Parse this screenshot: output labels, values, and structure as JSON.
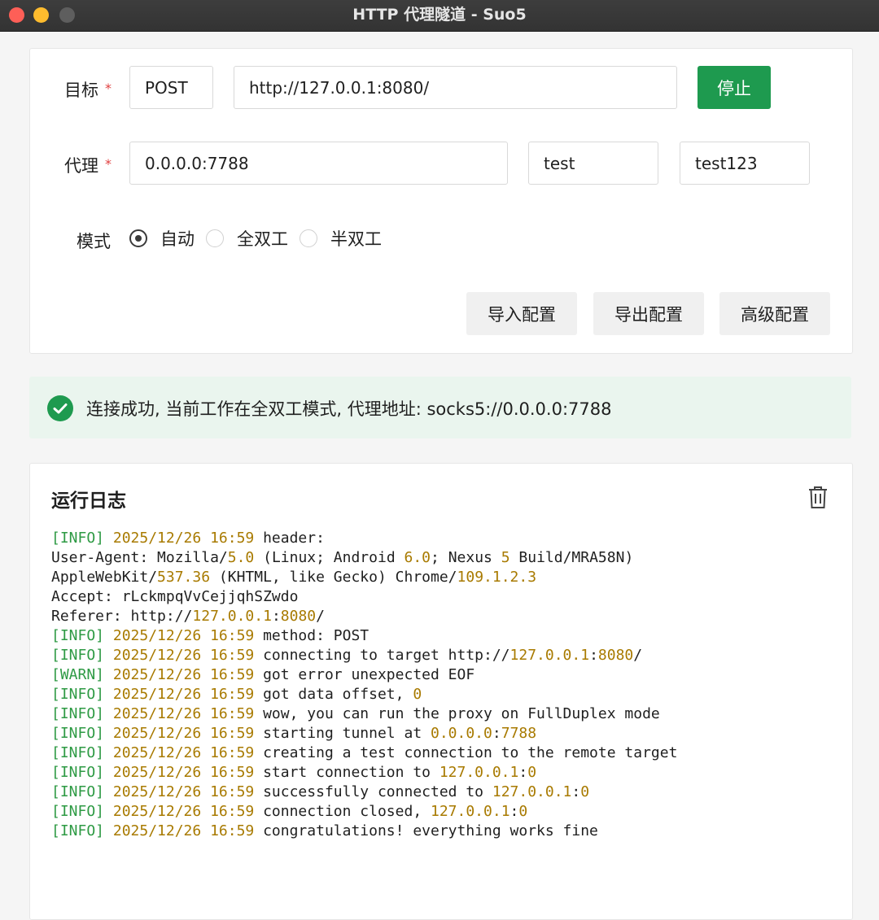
{
  "window": {
    "title": "HTTP 代理隧道 - Suo5"
  },
  "config": {
    "target_label": "目标",
    "proxy_label": "代理",
    "required_mark": "*",
    "method_value": "POST",
    "url_value": "http://127.0.0.1:8080/",
    "stop_label": "停止",
    "listen_value": "0.0.0.0:7788",
    "username_value": "test",
    "password_value": "test123",
    "mode_label": "模式",
    "modes": [
      {
        "label": "自动",
        "checked": true
      },
      {
        "label": "全双工",
        "checked": false
      },
      {
        "label": "半双工",
        "checked": false
      }
    ],
    "import_label": "导入配置",
    "export_label": "导出配置",
    "advanced_label": "高级配置"
  },
  "alert": {
    "text": "连接成功, 当前工作在全双工模式, 代理地址: socks5://0.0.0.0:7788"
  },
  "log": {
    "title": "运行日志",
    "lines": [
      [
        [
          "lv",
          "[INFO] "
        ],
        [
          "ts",
          "2025/12/26 16:59"
        ],
        [
          "t",
          " header:"
        ]
      ],
      [
        [
          "t",
          "User-Agent: Mozilla/"
        ],
        [
          "n",
          "5.0"
        ],
        [
          "t",
          " (Linux; Android "
        ],
        [
          "n",
          "6.0"
        ],
        [
          "t",
          "; Nexus "
        ],
        [
          "n",
          "5"
        ],
        [
          "t",
          " Build/MRA58N)"
        ]
      ],
      [
        [
          "t",
          "AppleWebKit/"
        ],
        [
          "n",
          "537.36"
        ],
        [
          "t",
          " (KHTML, like Gecko) Chrome/"
        ],
        [
          "n",
          "109.1.2.3"
        ]
      ],
      [
        [
          "t",
          "Accept: rLckmpqVvCejjqhSZwdo"
        ]
      ],
      [
        [
          "t",
          "Referer: http://"
        ],
        [
          "n",
          "127.0.0.1"
        ],
        [
          "t",
          ":"
        ],
        [
          "n",
          "8080"
        ],
        [
          "t",
          "/"
        ]
      ],
      [
        [
          "lv",
          "[INFO] "
        ],
        [
          "ts",
          "2025/12/26 16:59"
        ],
        [
          "t",
          " method: POST"
        ]
      ],
      [
        [
          "lv",
          "[INFO] "
        ],
        [
          "ts",
          "2025/12/26 16:59"
        ],
        [
          "t",
          " connecting to target http://"
        ],
        [
          "n",
          "127.0.0.1"
        ],
        [
          "t",
          ":"
        ],
        [
          "n",
          "8080"
        ],
        [
          "t",
          "/"
        ]
      ],
      [
        [
          "lv",
          "[WARN] "
        ],
        [
          "ts",
          "2025/12/26 16:59"
        ],
        [
          "t",
          " got error unexpected EOF"
        ]
      ],
      [
        [
          "lv",
          "[INFO] "
        ],
        [
          "ts",
          "2025/12/26 16:59"
        ],
        [
          "t",
          " got data offset, "
        ],
        [
          "n",
          "0"
        ]
      ],
      [
        [
          "lv",
          "[INFO] "
        ],
        [
          "ts",
          "2025/12/26 16:59"
        ],
        [
          "t",
          " wow, you can run the proxy on FullDuplex mode"
        ]
      ],
      [
        [
          "lv",
          "[INFO] "
        ],
        [
          "ts",
          "2025/12/26 16:59"
        ],
        [
          "t",
          " starting tunnel at "
        ],
        [
          "n",
          "0.0.0.0"
        ],
        [
          "t",
          ":"
        ],
        [
          "n",
          "7788"
        ]
      ],
      [
        [
          "lv",
          "[INFO] "
        ],
        [
          "ts",
          "2025/12/26 16:59"
        ],
        [
          "t",
          " creating a test connection to the remote target"
        ]
      ],
      [
        [
          "lv",
          "[INFO] "
        ],
        [
          "ts",
          "2025/12/26 16:59"
        ],
        [
          "t",
          " start connection to "
        ],
        [
          "n",
          "127.0.0.1"
        ],
        [
          "t",
          ":"
        ],
        [
          "n",
          "0"
        ]
      ],
      [
        [
          "lv",
          "[INFO] "
        ],
        [
          "ts",
          "2025/12/26 16:59"
        ],
        [
          "t",
          " successfully connected to "
        ],
        [
          "n",
          "127.0.0.1"
        ],
        [
          "t",
          ":"
        ],
        [
          "n",
          "0"
        ]
      ],
      [
        [
          "lv",
          "[INFO] "
        ],
        [
          "ts",
          "2025/12/26 16:59"
        ],
        [
          "t",
          " connection closed, "
        ],
        [
          "n",
          "127.0.0.1"
        ],
        [
          "t",
          ":"
        ],
        [
          "n",
          "0"
        ]
      ],
      [
        [
          "lv",
          "[INFO] "
        ],
        [
          "ts",
          "2025/12/26 16:59"
        ],
        [
          "t",
          " congratulations! everything works fine"
        ]
      ]
    ]
  },
  "colors": {
    "accent_green": "#1e9a4f",
    "alert_bg": "#eaf5ee",
    "log_level": "#2e9a44",
    "log_number": "#a87a00"
  },
  "icons": {
    "alert": "check-circle-icon",
    "clear_log": "trash-icon"
  }
}
